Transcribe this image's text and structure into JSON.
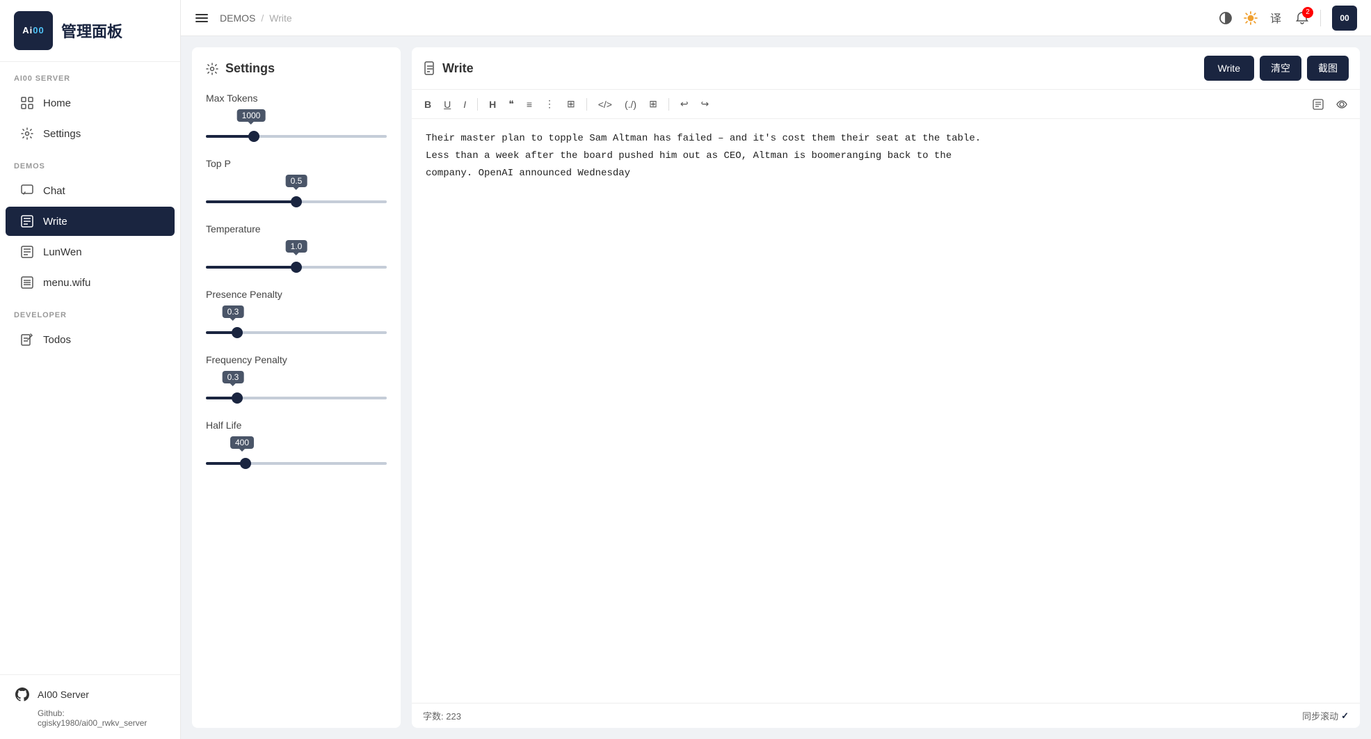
{
  "sidebar": {
    "logo_line1": "Ai00",
    "logo_line2": "管理面板",
    "sections": [
      {
        "label": "AI00 SERVER",
        "items": [
          {
            "id": "home",
            "label": "Home",
            "icon": "grid-icon"
          },
          {
            "id": "settings",
            "label": "Settings",
            "icon": "gear-icon"
          }
        ]
      },
      {
        "label": "DEMOS",
        "items": [
          {
            "id": "chat",
            "label": "Chat",
            "icon": "chat-icon"
          },
          {
            "id": "write",
            "label": "Write",
            "icon": "write-icon",
            "active": true
          },
          {
            "id": "lunwen",
            "label": "LunWen",
            "icon": "lunwen-icon"
          },
          {
            "id": "menu-wifu",
            "label": "menu.wifu",
            "icon": "menu-icon"
          }
        ]
      },
      {
        "label": "DEVELOPER",
        "items": [
          {
            "id": "todos",
            "label": "Todos",
            "icon": "todos-icon"
          }
        ]
      }
    ],
    "footer": {
      "github_label": "AI00 Server",
      "github_sub_label": "Github:",
      "github_link": "cgisky1980/ai00_rwkv_server"
    }
  },
  "header": {
    "breadcrumb": {
      "demos": "DEMOS",
      "separator": "/",
      "current": "Write"
    },
    "notification_count": "2",
    "avatar_text": "00"
  },
  "settings": {
    "title": "Settings",
    "max_tokens": {
      "label": "Max Tokens",
      "value": 1000,
      "min": 0,
      "max": 4000,
      "fill_pct": "25%"
    },
    "top_p": {
      "label": "Top P",
      "value": "0.5",
      "min": 0,
      "max": 1,
      "fill_pct": "50%"
    },
    "temperature": {
      "label": "Temperature",
      "value": "1.0",
      "min": 0,
      "max": 2,
      "fill_pct": "50%"
    },
    "presence_penalty": {
      "label": "Presence Penalty",
      "value": "0.3",
      "min": 0,
      "max": 2,
      "fill_pct": "15%"
    },
    "frequency_penalty": {
      "label": "Frequency Penalty",
      "value": "0.3",
      "min": 0,
      "max": 2,
      "fill_pct": "15%"
    },
    "half_life": {
      "label": "Half Life",
      "value": "400",
      "min": 0,
      "max": 2000,
      "fill_pct": "20%"
    }
  },
  "write": {
    "title": "Write",
    "btn_write": "Write",
    "btn_clear": "清空",
    "btn_screenshot": "截图",
    "content": "Their master plan to topple Sam Altman has failed – and it's cost them their seat at the table.\nLess than a week after the board pushed him out as CEO, Altman is boomeranging back to the\ncompany. OpenAI announced Wednesday",
    "word_count_label": "字数:",
    "word_count": "223",
    "sync_label": "同步滚动",
    "sync_icon": "✓"
  }
}
